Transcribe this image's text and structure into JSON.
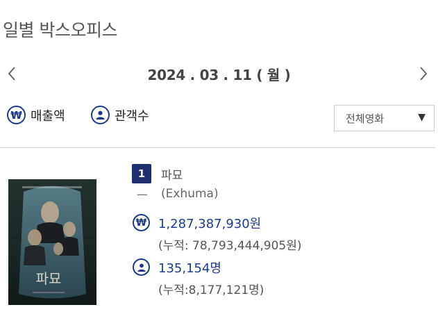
{
  "page": {
    "title": "일별 박스오피스"
  },
  "date_nav": {
    "prev_icon": "chevron-left",
    "next_icon": "chevron-right",
    "date": "2024 . 03 . 11 ( 월 )"
  },
  "toggles": [
    {
      "icon": "won-sign",
      "symbol": "₩",
      "label": "매출액"
    },
    {
      "icon": "person",
      "label": "관객수"
    }
  ],
  "filter": {
    "selected": "전체영화",
    "caret": "▼"
  },
  "colors": {
    "accent": "#1e3b8a",
    "badge": "#1e2f6b"
  },
  "movies": [
    {
      "rank": "1",
      "title": "파묘",
      "rank_change": "—",
      "english_title": "(Exhuma)",
      "sales_icon": "₩",
      "sales": "1,287,387,930원",
      "sales_cumulative": "(누적: 78,793,444,905원)",
      "audience": "135,154명",
      "audience_cumulative": "(누적:8,177,121명)",
      "poster_title": "파묘"
    }
  ]
}
